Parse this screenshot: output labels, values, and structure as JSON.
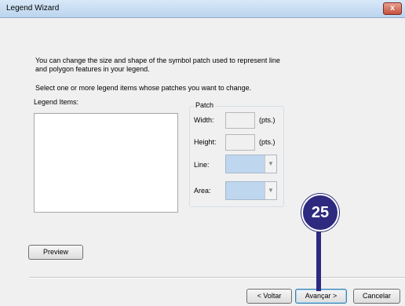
{
  "window": {
    "title": "Legend Wizard",
    "close_glyph": "x"
  },
  "intro": {
    "line1": "You can change the size and shape of the symbol patch used to represent line",
    "line2": "and polygon features in your legend.",
    "line3": "Select one or more legend items whose patches you want to change."
  },
  "legend_items": {
    "label": "Legend Items:",
    "items": []
  },
  "patch": {
    "group_label": "Patch",
    "width_label": "Width:",
    "width_value": "",
    "width_unit": "(pts.)",
    "height_label": "Height:",
    "height_value": "",
    "height_unit": "(pts.)",
    "line_label": "Line:",
    "line_value": "",
    "area_label": "Area:",
    "area_value": ""
  },
  "buttons": {
    "preview": "Preview",
    "back": "< Voltar",
    "next": "Avançar >",
    "cancel": "Cancelar"
  },
  "annotation": {
    "number": "25",
    "color": "#2d2a80"
  }
}
